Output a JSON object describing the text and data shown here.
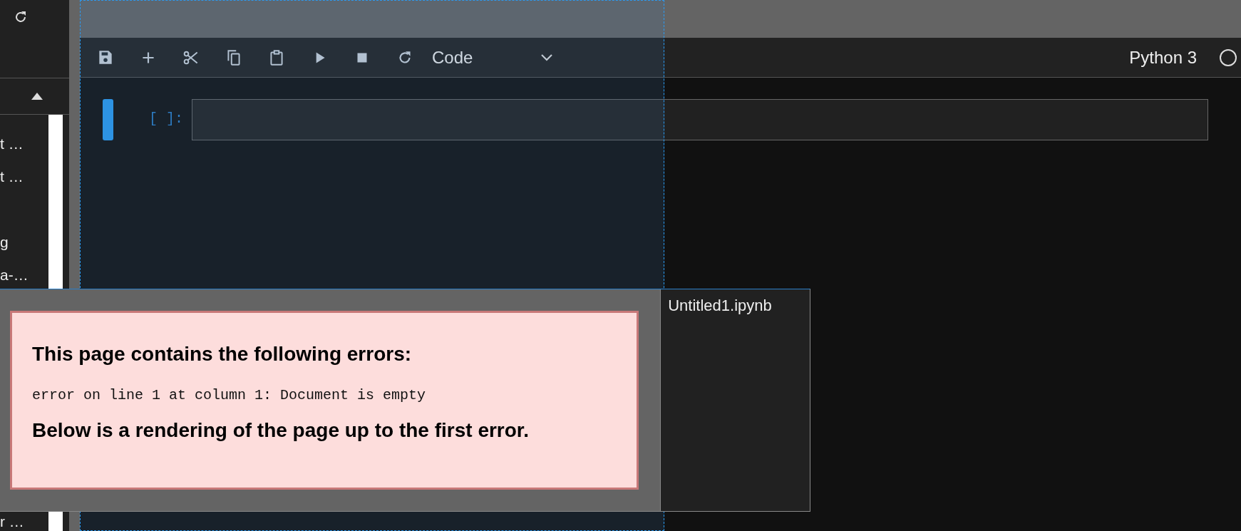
{
  "sidebar": {
    "items": [
      {
        "label": "t …"
      },
      {
        "label": "t …"
      },
      {
        "label": "g"
      },
      {
        "label": "a-…"
      },
      {
        "label": "r …"
      }
    ]
  },
  "toolbar": {
    "buttons": [
      {
        "kind": "save"
      },
      {
        "kind": "add"
      },
      {
        "kind": "cut"
      },
      {
        "kind": "copy"
      },
      {
        "kind": "paste"
      },
      {
        "kind": "run"
      },
      {
        "kind": "stop"
      },
      {
        "kind": "restart"
      }
    ],
    "cell_type": "Code",
    "kernel": {
      "name": "Python 3",
      "busy": false
    }
  },
  "cell": {
    "prompt": "[ ]:",
    "active": true
  },
  "error_popup": {
    "heading": "This page contains the following errors:",
    "message": "error on line 1 at column 1: Document is empty",
    "footer": "Below is a rendering of the page up to the first error.",
    "tab": "Untitled1.ipynb"
  }
}
